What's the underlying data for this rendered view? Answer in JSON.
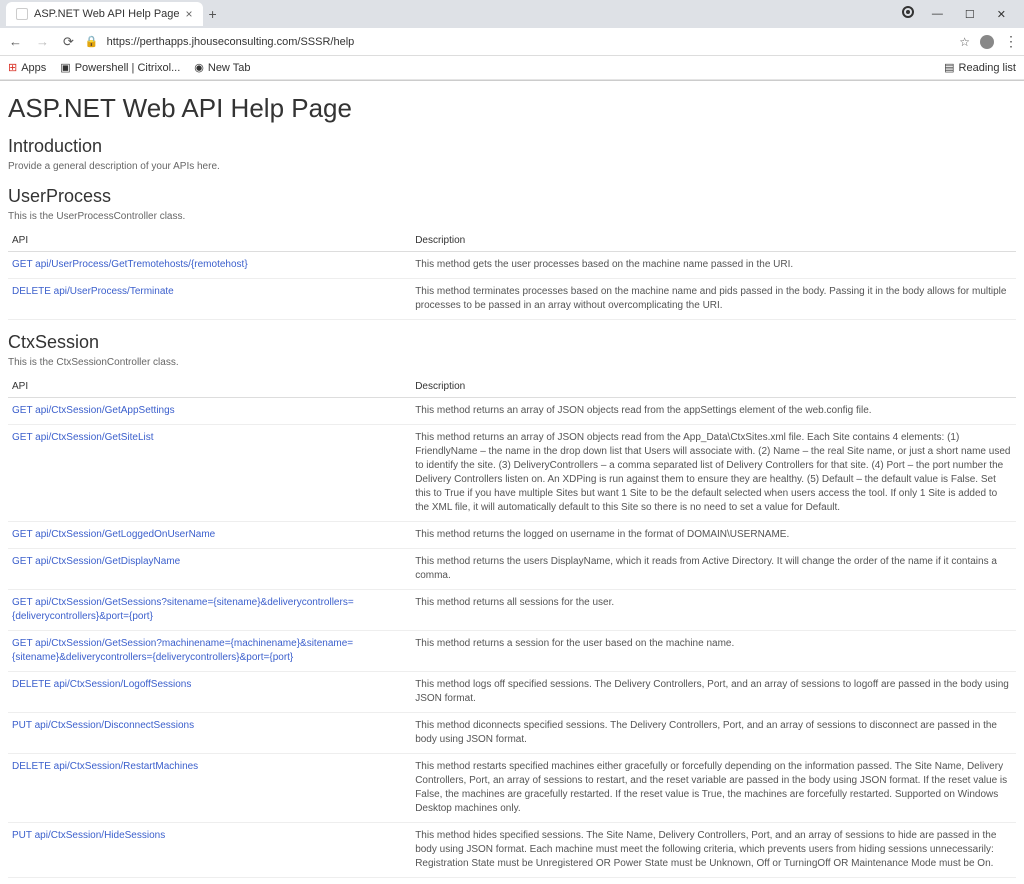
{
  "browser": {
    "tab_title": "ASP.NET Web API Help Page",
    "url": "https://perthapps.jhouseconsulting.com/SSSR/help",
    "bookmarks": {
      "apps": "Apps",
      "powershell": "Powershell | Citrixol...",
      "newtab": "New Tab",
      "reading_list": "Reading list"
    }
  },
  "page": {
    "title": "ASP.NET Web API Help Page",
    "intro_heading": "Introduction",
    "intro_text": "Provide a general description of your APIs here.",
    "sections": [
      {
        "heading": "UserProcess",
        "desc": "This is the UserProcessController class.",
        "table": {
          "col_api": "API",
          "col_desc": "Description",
          "rows": [
            {
              "api": "GET api/UserProcess/GetTremotehosts/{remotehost}",
              "desc": "This method gets the user processes based on the machine name passed in the URI."
            },
            {
              "api": "DELETE api/UserProcess/Terminate",
              "desc": "This method terminates processes based on the machine name and pids passed in the body. Passing it in the body allows for multiple processes to be passed in an array without overcomplicating the URI."
            }
          ]
        }
      },
      {
        "heading": "CtxSession",
        "desc": "This is the CtxSessionController class.",
        "table": {
          "col_api": "API",
          "col_desc": "Description",
          "rows": [
            {
              "api": "GET api/CtxSession/GetAppSettings",
              "desc": "This method returns an array of JSON objects read from the appSettings element of the web.config file."
            },
            {
              "api": "GET api/CtxSession/GetSiteList",
              "desc": "This method returns an array of JSON objects read from the App_Data\\CtxSites.xml file. Each Site contains 4 elements: (1) FriendlyName – the name in the drop down list that Users will associate with. (2) Name – the real Site name, or just a short name used to identify the site. (3) DeliveryControllers – a comma separated list of Delivery Controllers for that site. (4) Port – the port number the Delivery Controllers listen on. An XDPing is run against them to ensure they are healthy. (5) Default – the default value is False. Set this to True if you have multiple Sites but want 1 Site to be the default selected when users access the tool. If only 1 Site is added to the XML file, it will automatically default to this Site so there is no need to set a value for Default."
            },
            {
              "api": "GET api/CtxSession/GetLoggedOnUserName",
              "desc": "This method returns the logged on username in the format of DOMAIN\\USERNAME."
            },
            {
              "api": "GET api/CtxSession/GetDisplayName",
              "desc": "This method returns the users DisplayName, which it reads from Active Directory. It will change the order of the name if it contains a comma."
            },
            {
              "api": "GET api/CtxSession/GetSessions?sitename={sitename}&deliverycontrollers={deliverycontrollers}&port={port}",
              "desc": "This method returns all sessions for the user."
            },
            {
              "api": "GET api/CtxSession/GetSession?machinename={machinename}&sitename={sitename}&deliverycontrollers={deliverycontrollers}&port={port}",
              "desc": "This method returns a session for the user based on the machine name."
            },
            {
              "api": "DELETE api/CtxSession/LogoffSessions",
              "desc": "This method logs off specified sessions. The Delivery Controllers, Port, and an array of sessions to logoff are passed in the body using JSON format."
            },
            {
              "api": "PUT api/CtxSession/DisconnectSessions",
              "desc": "This method diconnects specified sessions. The Delivery Controllers, Port, and an array of sessions to disconnect are passed in the body using JSON format."
            },
            {
              "api": "DELETE api/CtxSession/RestartMachines",
              "desc": "This method restarts specified machines either gracefully or forcefully depending on the information passed. The Site Name, Delivery Controllers, Port, an array of sessions to restart, and the reset variable are passed in the body using JSON format. If the reset value is False, the machines are gracefully restarted. If the reset value is True, the machines are forcefully restarted. Supported on Windows Desktop machines only."
            },
            {
              "api": "PUT api/CtxSession/HideSessions",
              "desc": "This method hides specified sessions. The Site Name, Delivery Controllers, Port, and an array of sessions to hide are passed in the body using JSON format. Each machine must meet the following criteria, which prevents users from hiding sessions unnecessarily: Registration State must be Unregistered OR Power State must be Unknown, Off or TurningOff OR Maintenance Mode must be On."
            }
          ]
        }
      }
    ]
  }
}
